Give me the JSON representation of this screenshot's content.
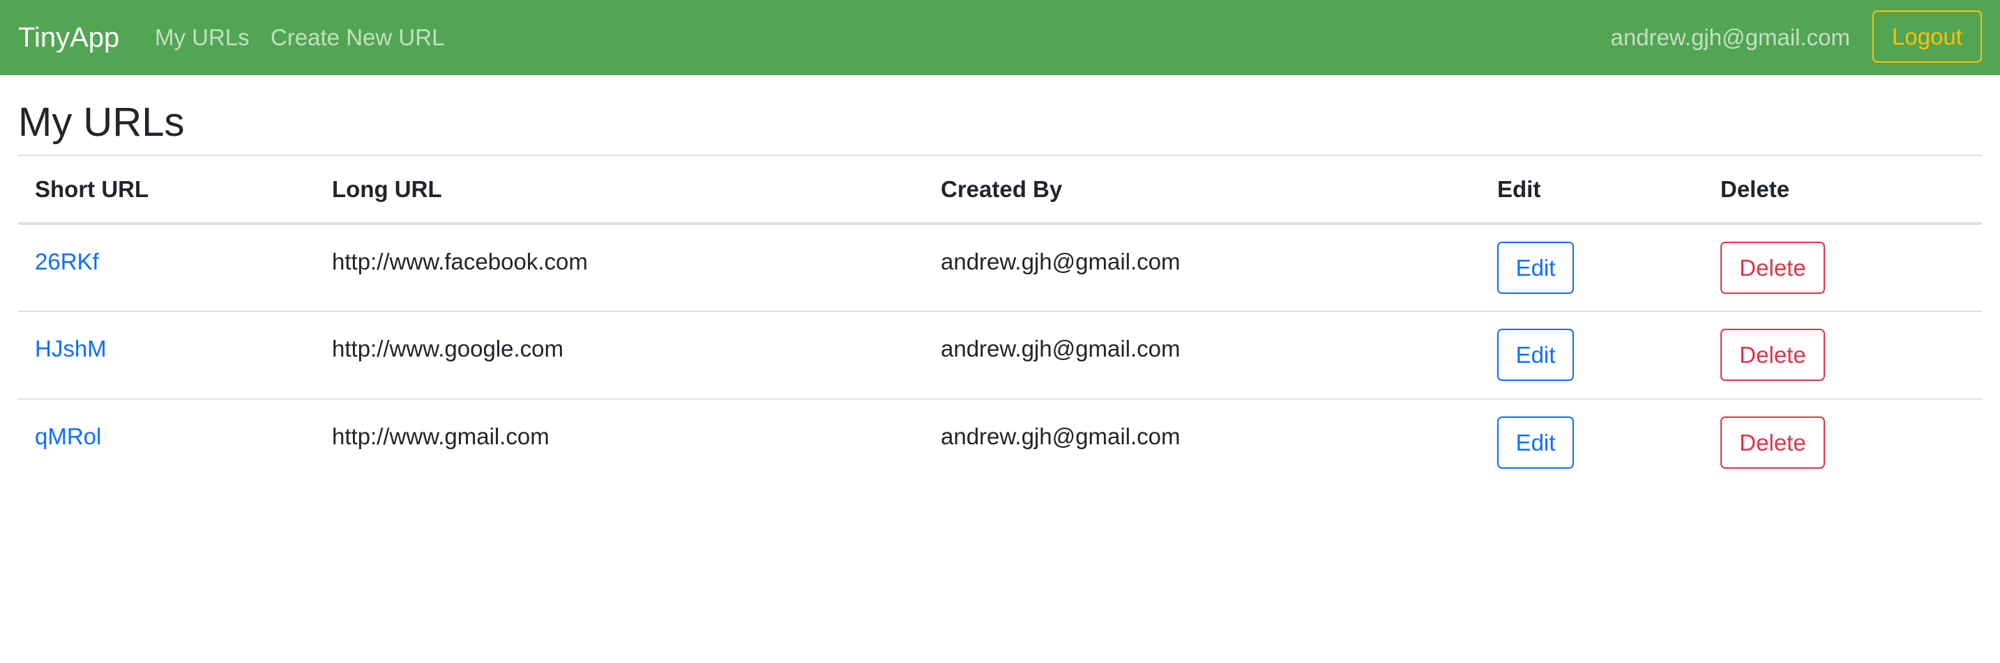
{
  "navbar": {
    "brand": "TinyApp",
    "links": [
      "My URLs",
      "Create New URL"
    ],
    "user_email": "andrew.gjh@gmail.com",
    "logout_label": "Logout",
    "background_color": "#52a552",
    "logout_color": "#ffc107"
  },
  "page": {
    "title": "My URLs"
  },
  "table": {
    "headers": [
      "Short URL",
      "Long URL",
      "Created By",
      "Edit",
      "Delete"
    ],
    "rows": [
      {
        "short_url": "26RKf",
        "long_url": "http://www.facebook.com",
        "created_by": "andrew.gjh@gmail.com",
        "edit_label": "Edit",
        "delete_label": "Delete"
      },
      {
        "short_url": "HJshM",
        "long_url": "http://www.google.com",
        "created_by": "andrew.gjh@gmail.com",
        "edit_label": "Edit",
        "delete_label": "Delete"
      },
      {
        "short_url": "qMRol",
        "long_url": "http://www.gmail.com",
        "created_by": "andrew.gjh@gmail.com",
        "edit_label": "Edit",
        "delete_label": "Delete"
      }
    ]
  },
  "colors": {
    "link": "#0d6efd",
    "edit": "#0d6efd",
    "delete": "#dc3545"
  }
}
